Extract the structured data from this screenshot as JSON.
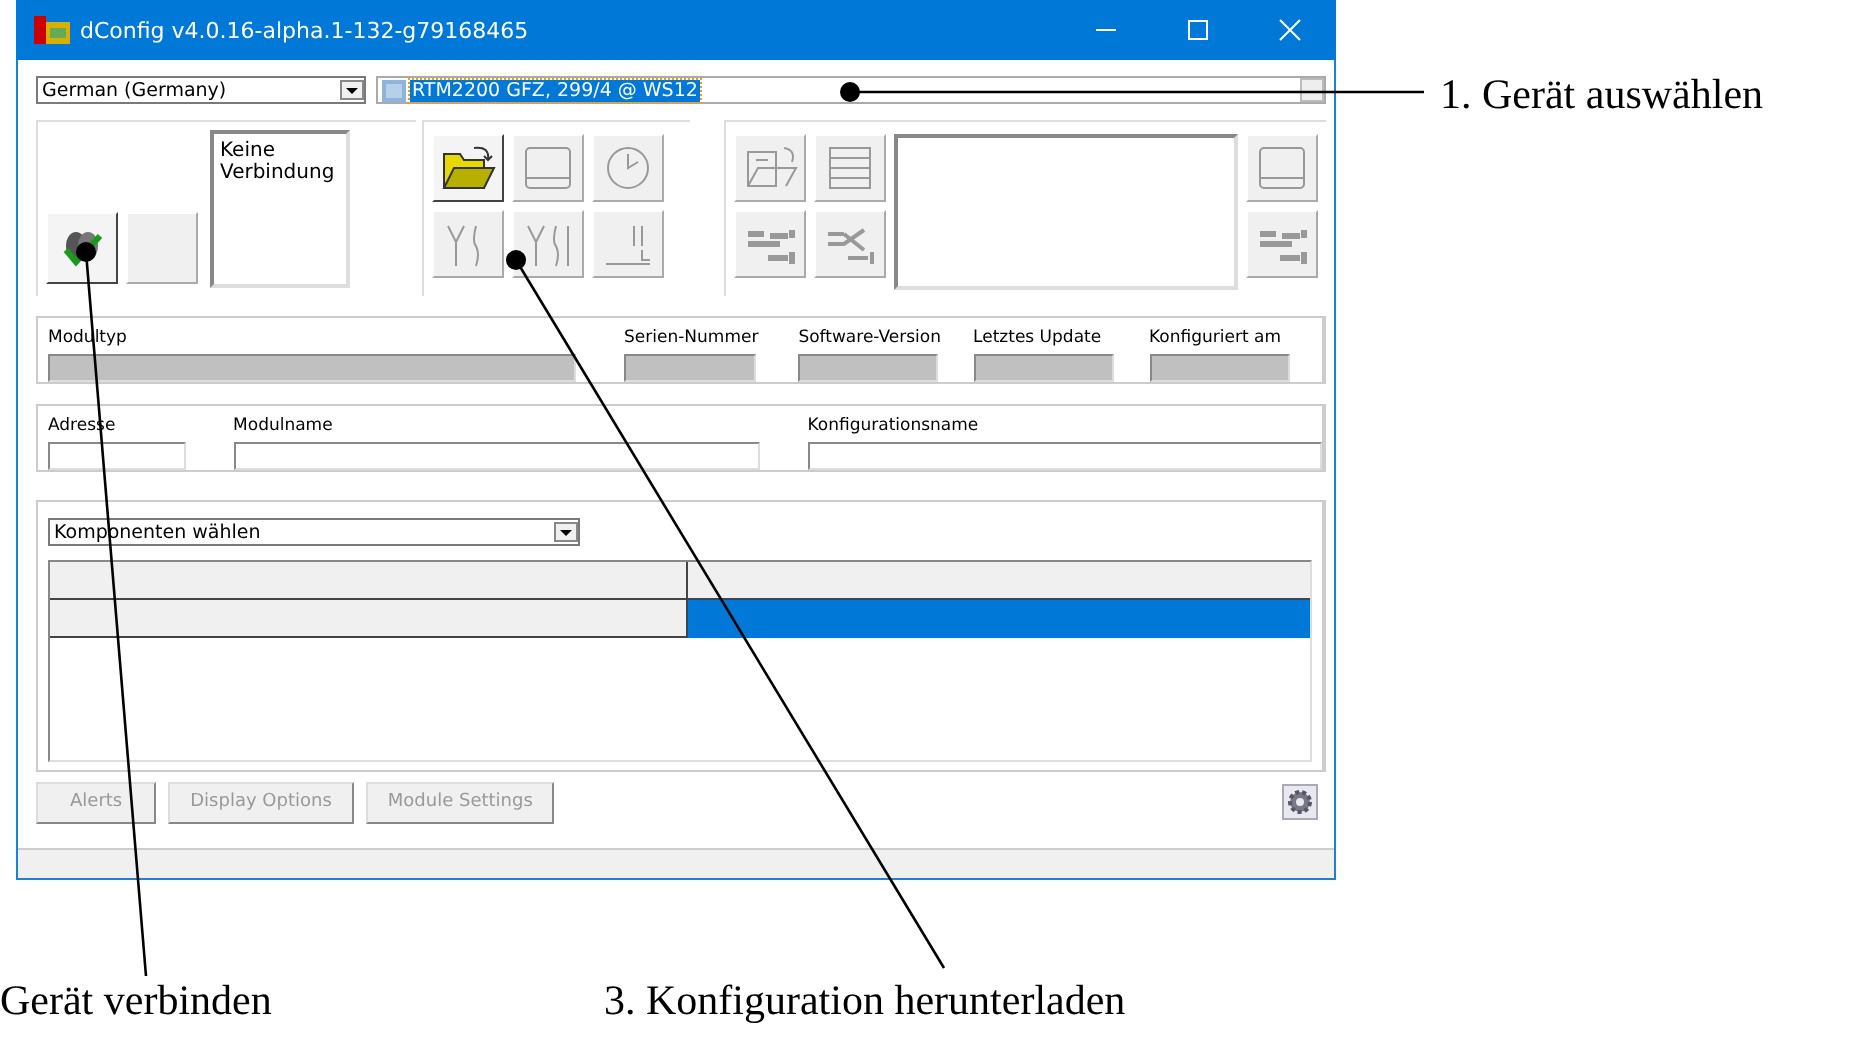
{
  "window": {
    "title": "dConfig v4.0.16-alpha.1-132-g79168465"
  },
  "language_combo": {
    "value": "German (Germany)"
  },
  "device_combo": {
    "value": "RTM2200 GFZ, 299/4 @ WS12",
    "selected": true
  },
  "connection": {
    "status": "Keine Verbindung",
    "buttons": [
      {
        "kind": "plug",
        "disabled": false
      },
      {
        "kind": "blank",
        "disabled": true
      }
    ]
  },
  "toolbar": [
    {
      "kind": "folder",
      "disabled": false
    },
    {
      "kind": "panel",
      "disabled": true
    },
    {
      "kind": "clock",
      "disabled": true
    },
    {
      "kind": "wire-a",
      "disabled": true
    },
    {
      "kind": "wire-b",
      "disabled": true
    },
    {
      "kind": "wire-c",
      "disabled": true
    }
  ],
  "toolbar_right": [
    {
      "kind": "doc-folder",
      "disabled": true
    },
    {
      "kind": "lines",
      "disabled": true
    },
    {
      "kind": "align-a",
      "disabled": true
    },
    {
      "kind": "align-b",
      "disabled": true
    }
  ],
  "toolbar_far_right": [
    {
      "kind": "panel",
      "disabled": true
    },
    {
      "kind": "align-a",
      "disabled": true
    }
  ],
  "info_fields": [
    {
      "label": "Modultyp",
      "readonly": true
    },
    {
      "label": "Serien-Nummer",
      "readonly": true
    },
    {
      "label": "Software-Version",
      "readonly": true
    },
    {
      "label": "Letztes Update",
      "readonly": true
    },
    {
      "label": "Konfiguriert am",
      "readonly": true
    }
  ],
  "name_fields": [
    {
      "label": "Adresse",
      "readonly": false
    },
    {
      "label": "Modulname",
      "readonly": false
    },
    {
      "label": "Konfigurationsname",
      "readonly": false
    }
  ],
  "components_combo": {
    "value": "Komponenten wählen"
  },
  "grid": {
    "rows": [
      {
        "selected": true
      }
    ]
  },
  "buttons": [
    {
      "label": "Alerts",
      "disabled": true
    },
    {
      "label": "Display Options",
      "disabled": true
    },
    {
      "label": "Module Settings",
      "disabled": true
    }
  ],
  "annotations": [
    {
      "text": "1. Gerät auswählen"
    },
    {
      "text": "Gerät verbinden"
    },
    {
      "text": "3. Konfiguration herunterladen"
    }
  ]
}
